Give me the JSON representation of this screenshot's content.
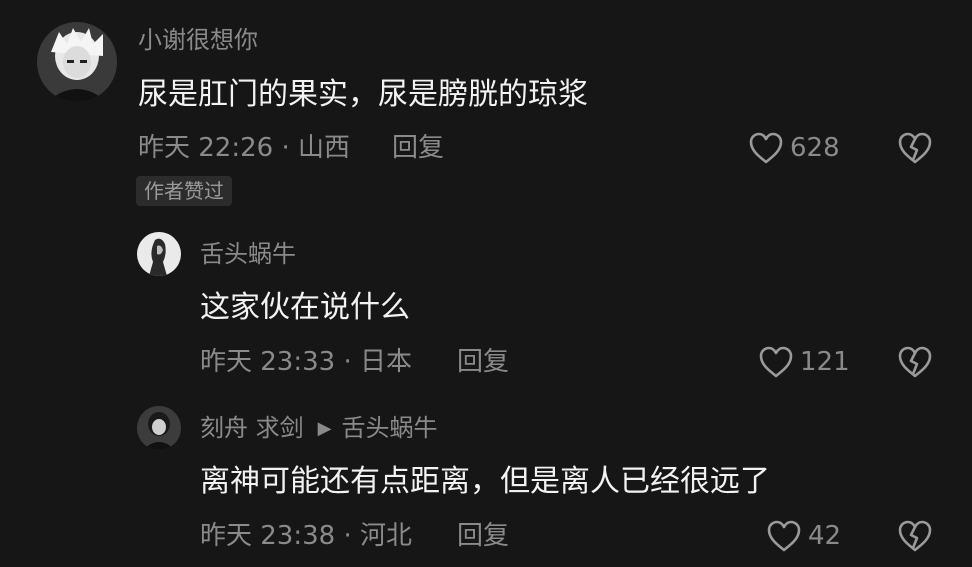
{
  "comments": [
    {
      "username": "小谢很想你",
      "content": "尿是肛门的果实，尿是膀胱的琼浆",
      "meta": "昨天 22:26 · 山西",
      "reply_label": "回复",
      "likes": "628",
      "badge": "作者赞过"
    },
    {
      "username": "舌头蜗牛",
      "content": "这家伙在说什么",
      "meta": "昨天 23:33 · 日本",
      "reply_label": "回复",
      "likes": "121"
    },
    {
      "username": "刻舟 求剑",
      "reply_to": "舌头蜗牛",
      "content": "离神可能还有点距离，但是离人已经很远了",
      "meta": "昨天 23:38 · 河北",
      "reply_label": "回复",
      "likes": "42"
    }
  ],
  "icons": {
    "like": "heart-outline-icon",
    "dislike": "broken-heart-icon",
    "reply_arrow": "play-triangle-icon"
  },
  "colors": {
    "background": "#161616",
    "primary_text": "#f2f2f2",
    "secondary_text": "#8a8a8a",
    "badge_bg": "#2c2c2c"
  }
}
